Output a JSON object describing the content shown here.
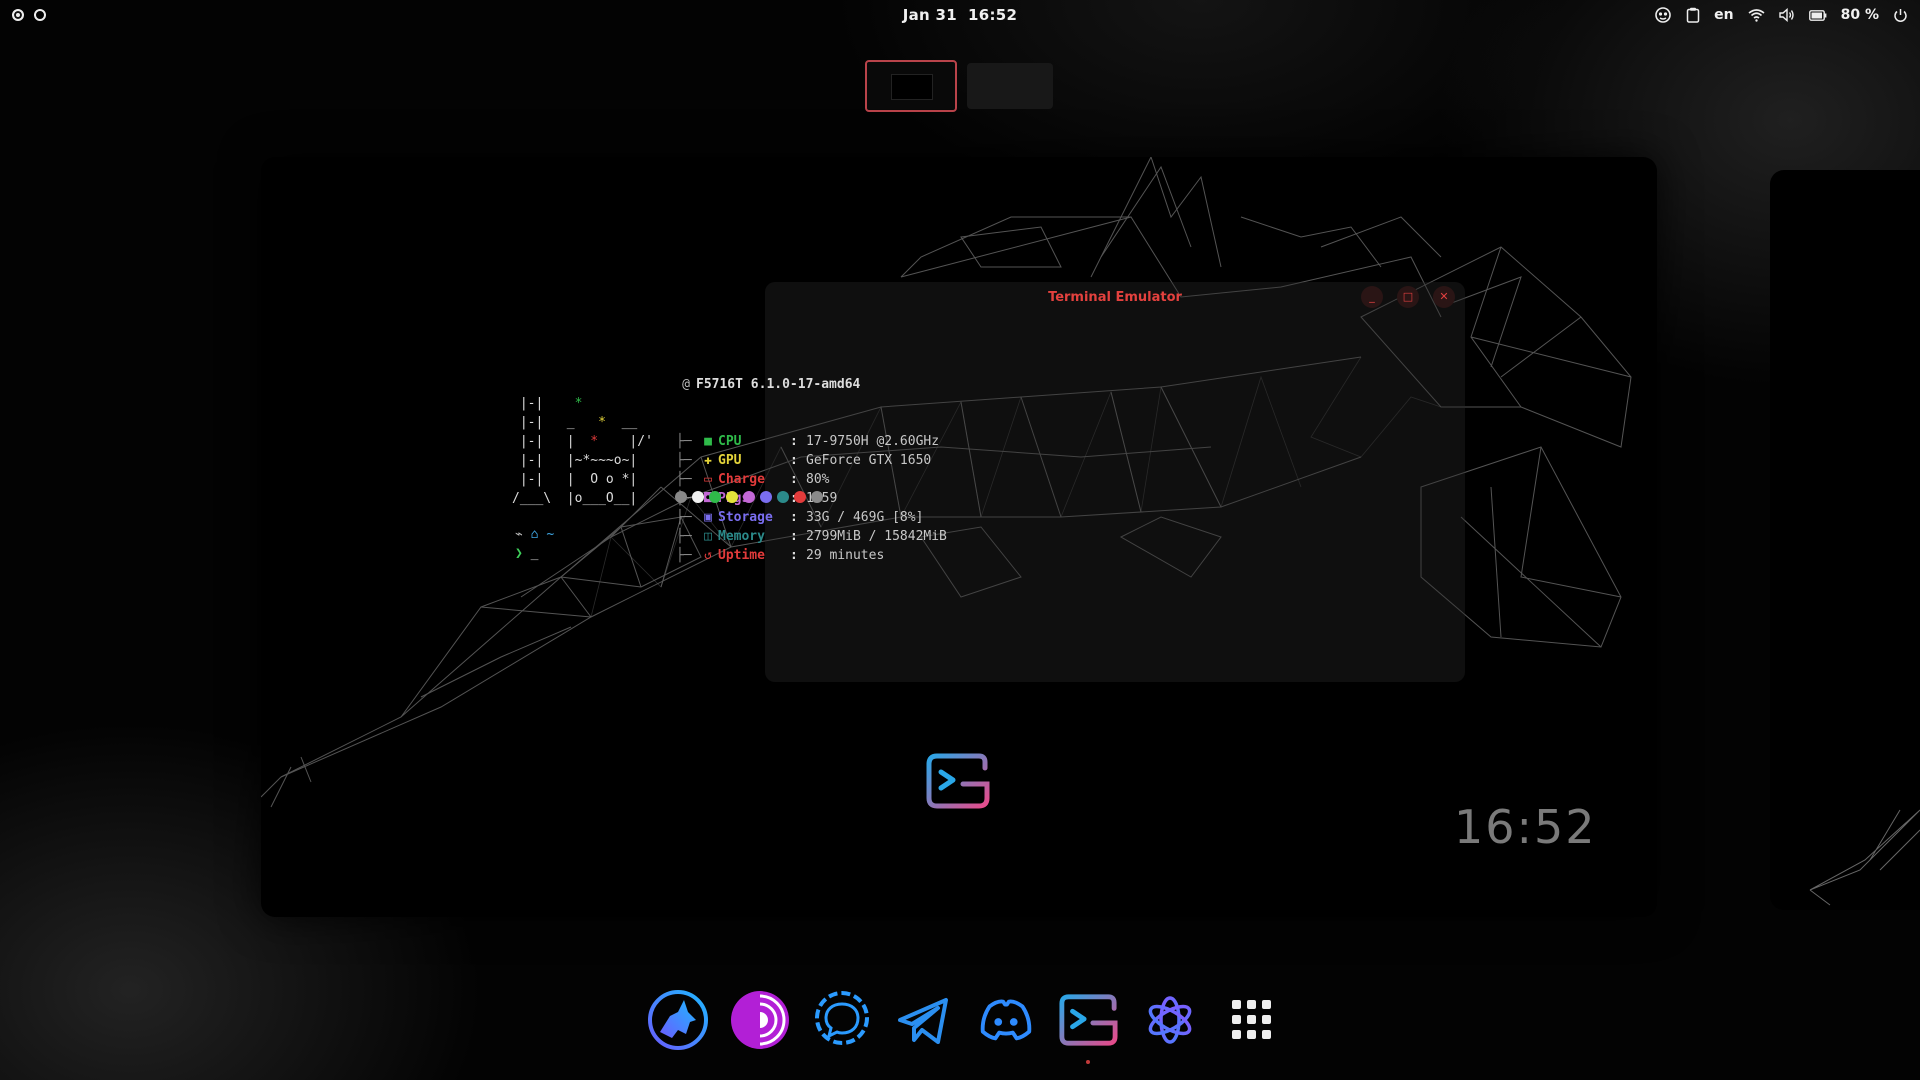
{
  "topbar": {
    "date": "Jan 31",
    "time": "16:52",
    "language": "en",
    "battery_percent": "80 %",
    "tray_icons": [
      "screenshot-icon",
      "clipboard-icon",
      "wifi-icon",
      "volume-icon",
      "battery-icon",
      "power-icon"
    ]
  },
  "workspaces": {
    "count": 2,
    "active": 1
  },
  "terminal": {
    "title": "Terminal Emulator",
    "buttons": {
      "minimize": "_",
      "maximize": "□",
      "close": "✕"
    },
    "host_line": "F5716T 6.1.0-17-amd64",
    "ascii_art": [
      " |-|    *",
      " |-|   _   *  __",
      " |-|   |  *    |/'",
      " |-|   |~*~~~o~|",
      " |-|   |  O o *|",
      "/___\\  |o___O__|"
    ],
    "info": [
      {
        "label": "CPU",
        "value": "17-9750H @2.60GHz",
        "color": "#2fbb4a",
        "icon": "cpu-icon"
      },
      {
        "label": "GPU",
        "value": "GeForce GTX 1650",
        "color": "#e3d33a",
        "icon": "gpu-icon"
      },
      {
        "label": "Charge",
        "value": "80%",
        "color": "#e23b3b",
        "icon": "battery-charge-icon"
      },
      {
        "label": "Pkgs",
        "value": "1759",
        "color": "#c368d6",
        "icon": "package-icon"
      },
      {
        "label": "Storage",
        "value": "33G / 469G [8%]",
        "color": "#7a6ef0",
        "icon": "storage-icon"
      },
      {
        "label": "Memory",
        "value": "2799MiB / 15842MiB",
        "color": "#2b8a8a",
        "icon": "memory-icon"
      },
      {
        "label": "Uptime",
        "value": "29 minutes",
        "color": "#e23b3b",
        "icon": "uptime-icon"
      }
    ],
    "palette": [
      "#888888",
      "#f2f2f2",
      "#2fbb4a",
      "#e3e33a",
      "#c368d6",
      "#7a6ef0",
      "#2b8a8a",
      "#e23b3b",
      "#8a8a8a"
    ],
    "prompt_path": "~",
    "prompt_symbol": "❯",
    "cursor": "_"
  },
  "workspace_clock": "16:52",
  "dock": {
    "apps": [
      "librewolf-icon",
      "tor-browser-icon",
      "signal-icon",
      "telegram-icon",
      "discord-icon",
      "terminal-icon",
      "chatgpt-icon",
      "app-grid-icon"
    ],
    "running": "terminal-icon"
  }
}
